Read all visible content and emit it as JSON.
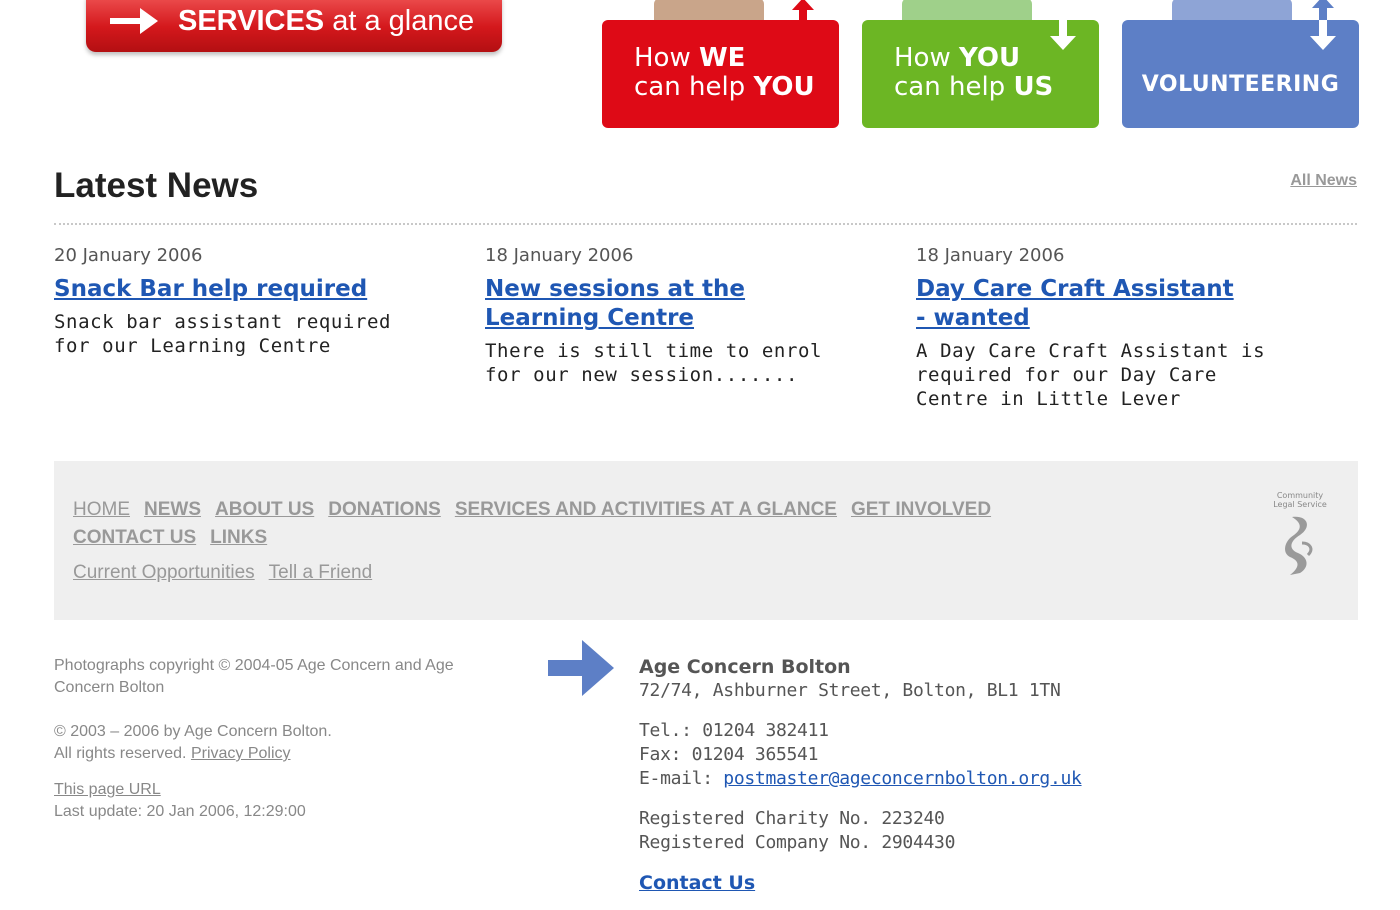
{
  "banners": {
    "services": {
      "word": "SERVICES",
      "rest": "at a glance"
    },
    "promo_we": {
      "line1_a": "How ",
      "line1_b": "WE",
      "line2_a": "can help ",
      "line2_b": "YOU"
    },
    "promo_you": {
      "line1_a": "How ",
      "line1_b": "YOU",
      "line2_a": "can help ",
      "line2_b": "US"
    },
    "volunteering": "VOLUNTEERING"
  },
  "news": {
    "title": "Latest News",
    "all_link": "All News",
    "items": [
      {
        "date": "20 January 2006",
        "headline": "Snack Bar help required",
        "summary": "Snack bar assistant required for our Learning Centre"
      },
      {
        "date": "18 January 2006",
        "headline": "New sessions at the Learning Centre",
        "summary": "There is still time to enrol for our new session......."
      },
      {
        "date": "18 January 2006",
        "headline": "Day Care Craft Assistant - wanted",
        "summary": "A Day Care Craft Assistant is required for our Day Care Centre in Little Lever"
      }
    ]
  },
  "footer_nav": {
    "primary": [
      "HOME",
      "NEWS",
      "ABOUT US",
      "DONATIONS",
      "SERVICES AND ACTIVITIES AT A GLANCE",
      "GET INVOLVED"
    ],
    "primary2": [
      "CONTACT US",
      "LINKS"
    ],
    "secondary": [
      "Current Opportunities",
      "Tell a Friend"
    ],
    "logo_text": "Community Legal Service"
  },
  "copyright": {
    "photos": "Photographs copyright © 2004-05 Age Concern and Age Concern Bolton",
    "rights_line1": "© 2003 – 2006 by Age Concern Bolton.",
    "rights_line2": "All rights reserved.",
    "privacy": "Privacy Policy",
    "page_url": "This page URL",
    "last_update": "Last update: 20 Jan 2006, 12:29:00"
  },
  "contact": {
    "org": "Age Concern Bolton",
    "address": "72/74, Ashburner Street, Bolton, BL1 1TN",
    "tel": "Tel.: 01204 382411",
    "fax": "Fax: 01204 365541",
    "email_label": "E-mail: ",
    "email": "postmaster@ageconcernbolton.org.uk",
    "charity": "Registered Charity No. 223240",
    "company": "Registered Company No. 2904430",
    "contact_link": "Contact Us"
  }
}
